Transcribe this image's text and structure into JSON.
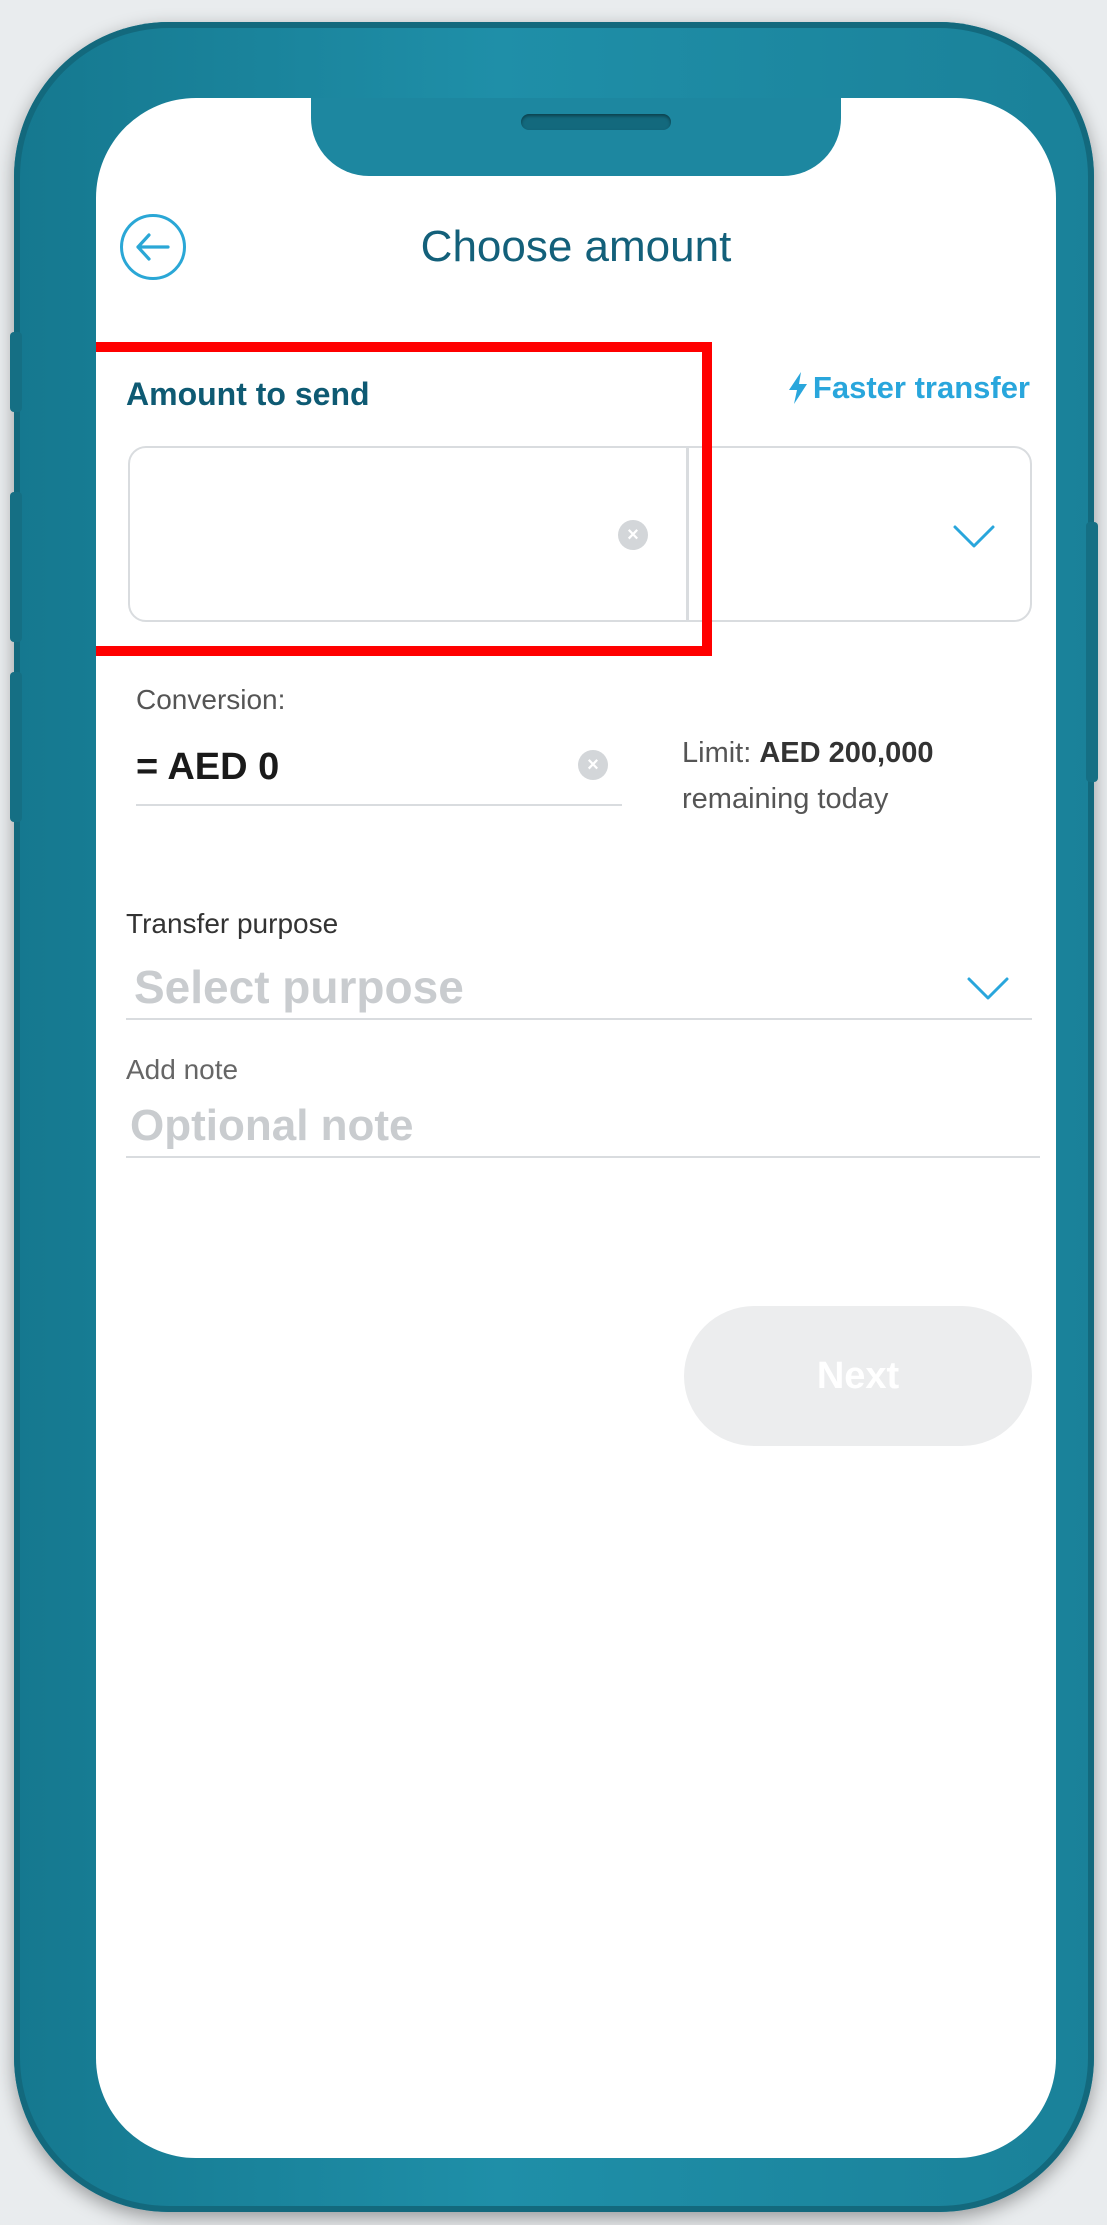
{
  "header": {
    "title": "Choose amount"
  },
  "amount": {
    "label": "Amount to send",
    "faster_transfer": "Faster transfer",
    "value": "",
    "currency": ""
  },
  "conversion": {
    "label": "Conversion:",
    "value": "= AED 0"
  },
  "limit": {
    "prefix": "Limit:",
    "amount": "AED 200,000",
    "suffix": "remaining today"
  },
  "purpose": {
    "label": "Transfer purpose",
    "placeholder": "Select purpose"
  },
  "note": {
    "label": "Add note",
    "placeholder": "Optional note"
  },
  "actions": {
    "next_label": "Next"
  },
  "colors": {
    "brand_teal": "#1d87a0",
    "accent_blue": "#29a6dc",
    "title_teal": "#13607a",
    "highlight_red": "#ff0000"
  }
}
